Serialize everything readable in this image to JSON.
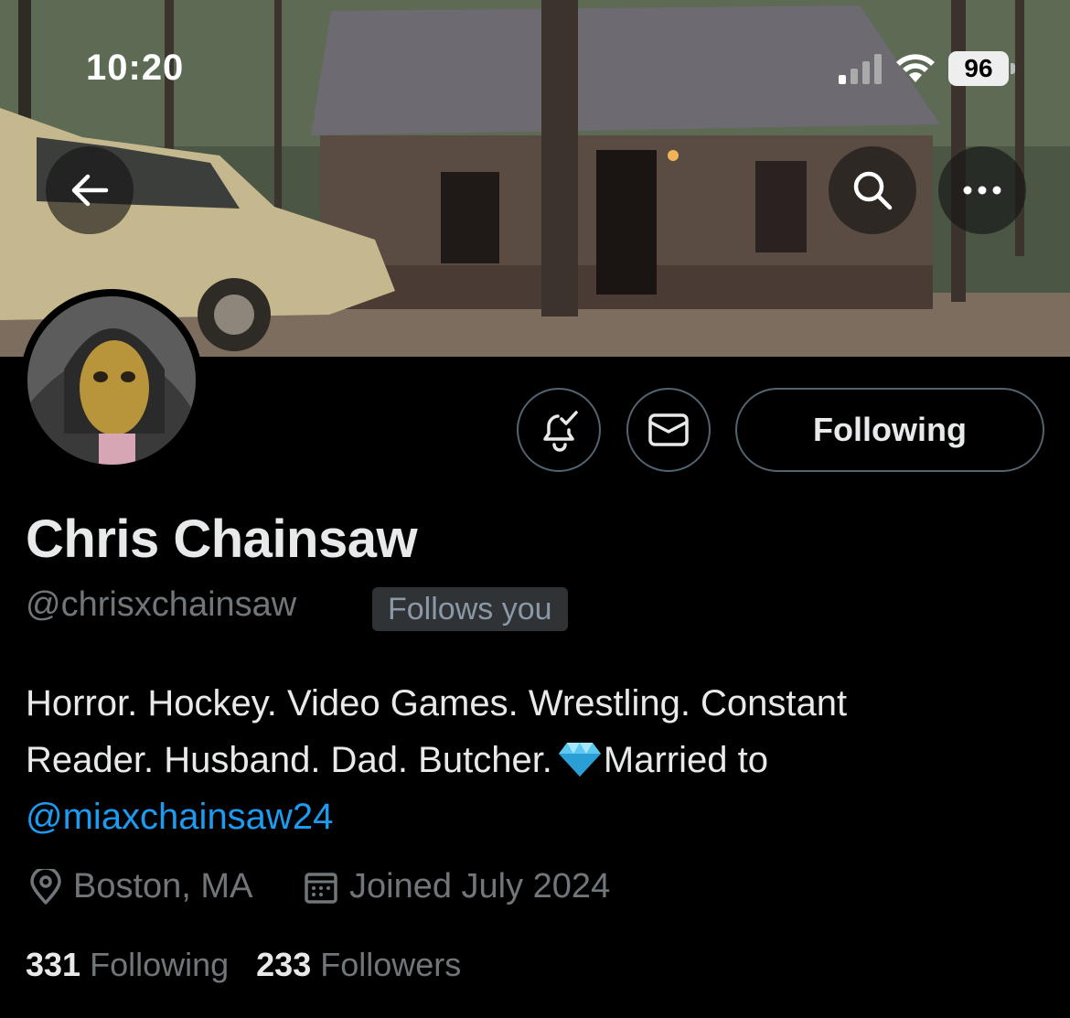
{
  "status_bar": {
    "time": "10:20",
    "battery": "96"
  },
  "banner": {
    "icon_back": "arrow-left-icon",
    "icon_search": "search-icon",
    "icon_more": "more-horizontal-icon"
  },
  "actions": {
    "notify_icon": "bell-check-icon",
    "message_icon": "envelope-icon",
    "following_label": "Following"
  },
  "profile": {
    "display_name": "Chris Chainsaw",
    "handle": "@chrisxchainsaw",
    "follows_you": "Follows you",
    "bio_line1": "Horror. Hockey. Video Games. Wrestling. Constant",
    "bio_line2a": "Reader. Husband. Dad. Butcher.",
    "bio_line2b": "Married to",
    "bio_mention": "@miaxchainsaw24",
    "location": "Boston, MA",
    "joined": "Joined July 2024",
    "following_count": "331",
    "following_label": "Following",
    "followers_count": "233",
    "followers_label": "Followers"
  },
  "colors": {
    "link": "#1d9bf0",
    "muted": "#71767b",
    "text": "#e7e9ea",
    "border": "#536471"
  }
}
